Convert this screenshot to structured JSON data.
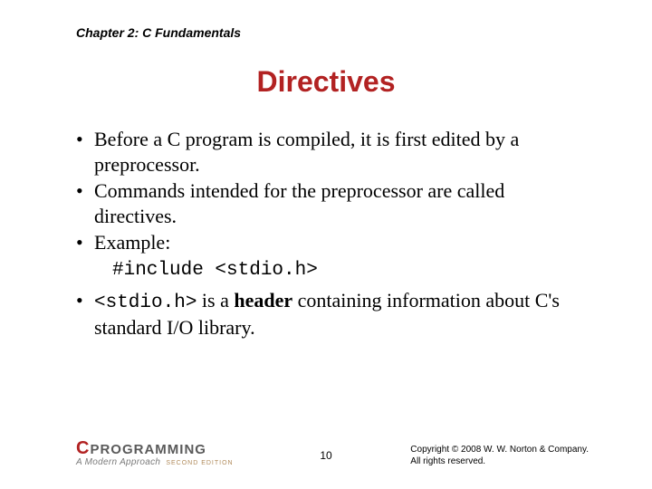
{
  "header": {
    "chapter": "Chapter 2: C Fundamentals"
  },
  "title": "Directives",
  "bullets": {
    "b1": "Before a C program is compiled, it is first edited by a preprocessor.",
    "b2": "Commands intended for the preprocessor are called directives.",
    "b3": "Example:",
    "code": "#include <stdio.h>",
    "b4_code": "<stdio.h>",
    "b4_mid1": " is a ",
    "b4_bold": "header",
    "b4_mid2": " containing information about C's standard I/O library."
  },
  "footer": {
    "logo_c": "C",
    "logo_text": "PROGRAMMING",
    "logo_sub": "A Modern Approach",
    "logo_edition": "SECOND EDITION",
    "page": "10",
    "copyright_l1": "Copyright © 2008 W. W. Norton & Company.",
    "copyright_l2": "All rights reserved."
  }
}
